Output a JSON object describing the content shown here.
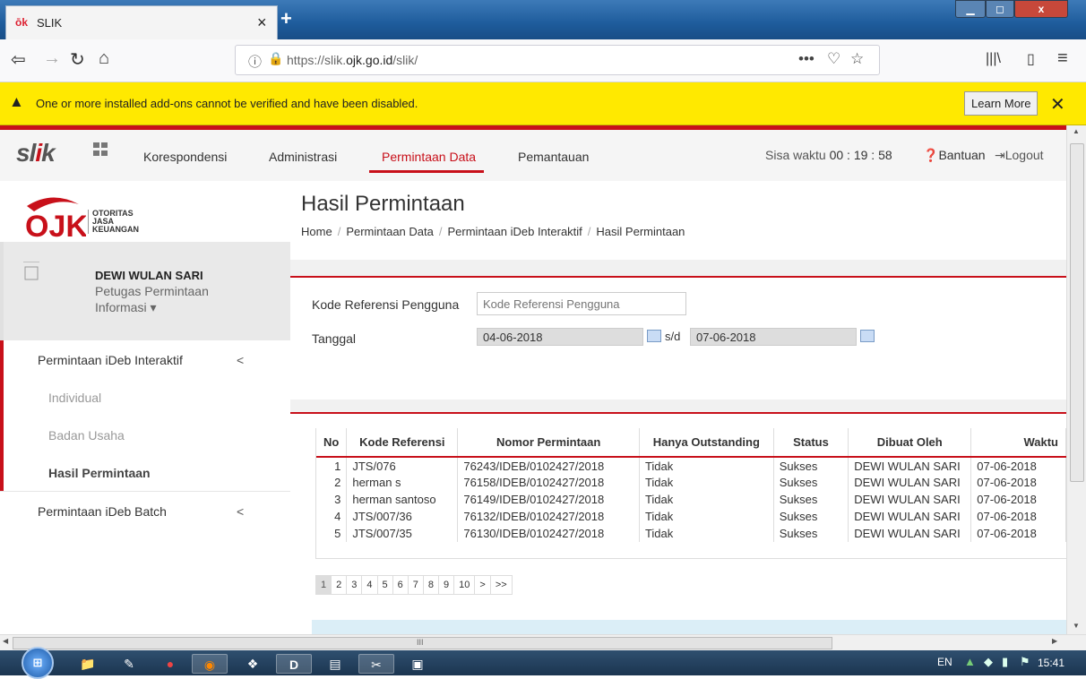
{
  "browser": {
    "tab_title": "SLIK",
    "tab_icon": "ojk-favicon",
    "url_prefix": "https://slik.",
    "url_domain": "ojk.go.id",
    "url_suffix": "/slik/",
    "more_label": "•••"
  },
  "notification": {
    "message": "One or more installed add-ons cannot be verified and have been disabled.",
    "learn_more": "Learn More"
  },
  "header": {
    "logo": "slik",
    "menu": [
      "Korespondensi",
      "Administrasi",
      "Permintaan Data",
      "Pemantauan"
    ],
    "active_menu": "Permintaan Data",
    "sisa_waktu_label": "Sisa waktu",
    "sisa_waktu": "00 : 19 : 58",
    "bantuan": "Bantuan",
    "logout": "Logout",
    "accent_color": "#c8101a"
  },
  "sidebar": {
    "org_line1": "OTORITAS",
    "org_line2": "JASA",
    "org_line3": "KEUANGAN",
    "user_name": "DEWI WULAN SARI",
    "user_role_line1": "Petugas Permintaan",
    "user_role_line2": "Informasi",
    "items": [
      {
        "label": "Permintaan iDeb Interaktif",
        "chevron": "<"
      },
      {
        "label": "Individual"
      },
      {
        "label": "Badan Usaha"
      },
      {
        "label": "Hasil Permintaan"
      },
      {
        "label": "Permintaan iDeb Batch",
        "chevron": "<"
      }
    ]
  },
  "main": {
    "title": "Hasil Permintaan",
    "breadcrumb": [
      "Home",
      "Permintaan Data",
      "Permintaan iDeb Interaktif",
      "Hasil Permintaan"
    ],
    "filter": {
      "kode_label": "Kode Referensi Pengguna",
      "kode_placeholder": "Kode Referensi Pengguna",
      "tanggal_label": "Tanggal",
      "date_from": "04-06-2018",
      "sd_label": "s/d",
      "date_to": "07-06-2018"
    },
    "table": {
      "columns": [
        "No",
        "Kode Referensi",
        "Nomor Permintaan",
        "Hanya Outstanding",
        "Status",
        "Dibuat Oleh",
        "Waktu"
      ],
      "rows": [
        [
          "1",
          "JTS/076",
          "76243/IDEB/0102427/2018",
          "Tidak",
          "Sukses",
          "DEWI WULAN SARI",
          "07-06-2018"
        ],
        [
          "2",
          "herman s",
          "76158/IDEB/0102427/2018",
          "Tidak",
          "Sukses",
          "DEWI WULAN SARI",
          "07-06-2018"
        ],
        [
          "3",
          "herman santoso",
          "76149/IDEB/0102427/2018",
          "Tidak",
          "Sukses",
          "DEWI WULAN SARI",
          "07-06-2018"
        ],
        [
          "4",
          "JTS/007/36",
          "76132/IDEB/0102427/2018",
          "Tidak",
          "Sukses",
          "DEWI WULAN SARI",
          "07-06-2018"
        ],
        [
          "5",
          "JTS/007/35",
          "76130/IDEB/0102427/2018",
          "Tidak",
          "Sukses",
          "DEWI WULAN SARI",
          "07-06-2018"
        ]
      ]
    },
    "pager": [
      "1",
      "2",
      "3",
      "4",
      "5",
      "6",
      "7",
      "8",
      "9",
      "10",
      ">",
      ">>"
    ],
    "pager_current": "1"
  },
  "taskbar": {
    "lang": "EN",
    "time": "15:41",
    "scroll_marker": "III"
  }
}
